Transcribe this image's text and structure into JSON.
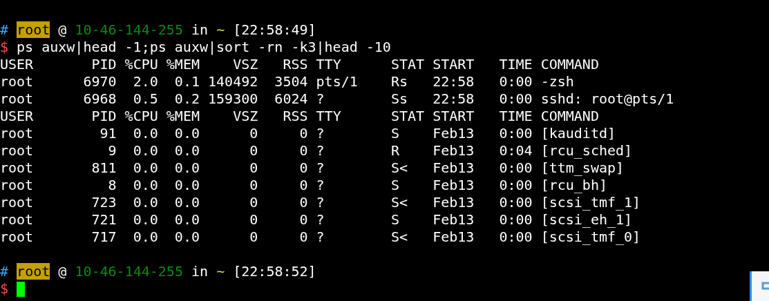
{
  "terminal": {
    "sessions": [
      {
        "prompt": {
          "hash": "#",
          "user": "root",
          "at": "@",
          "host": "10-46-144-255",
          "in": "in",
          "dir": "~",
          "time": "[22:58:49]",
          "dollar": "$"
        },
        "command": "ps auxw|head -1;ps auxw|sort -rn -k3|head -10",
        "output": [
          "USER       PID %CPU %MEM    VSZ   RSS TTY      STAT START   TIME COMMAND",
          "root      6970  2.0  0.1 140492  3504 pts/1    Rs   22:58   0:00 -zsh",
          "root      6968  0.5  0.2 159300  6024 ?        Ss   22:58   0:00 sshd: root@pts/1",
          "USER       PID %CPU %MEM    VSZ   RSS TTY      STAT START   TIME COMMAND",
          "root        91  0.0  0.0      0     0 ?        S    Feb13   0:00 [kauditd]",
          "root         9  0.0  0.0      0     0 ?        R    Feb13   0:04 [rcu_sched]",
          "root       811  0.0  0.0      0     0 ?        S<   Feb13   0:00 [ttm_swap]",
          "root         8  0.0  0.0      0     0 ?        S    Feb13   0:00 [rcu_bh]",
          "root       723  0.0  0.0      0     0 ?        S<   Feb13   0:00 [scsi_tmf_1]",
          "root       721  0.0  0.0      0     0 ?        S    Feb13   0:00 [scsi_eh_1]",
          "root       717  0.0  0.0      0     0 ?        S<   Feb13   0:00 [scsi_tmf_0]"
        ]
      },
      {
        "prompt": {
          "hash": "#",
          "user": "root",
          "at": "@",
          "host": "10-46-144-255",
          "in": "in",
          "dir": "~",
          "time": "[22:58:52]",
          "dollar": "$"
        },
        "cursor": true
      }
    ]
  }
}
